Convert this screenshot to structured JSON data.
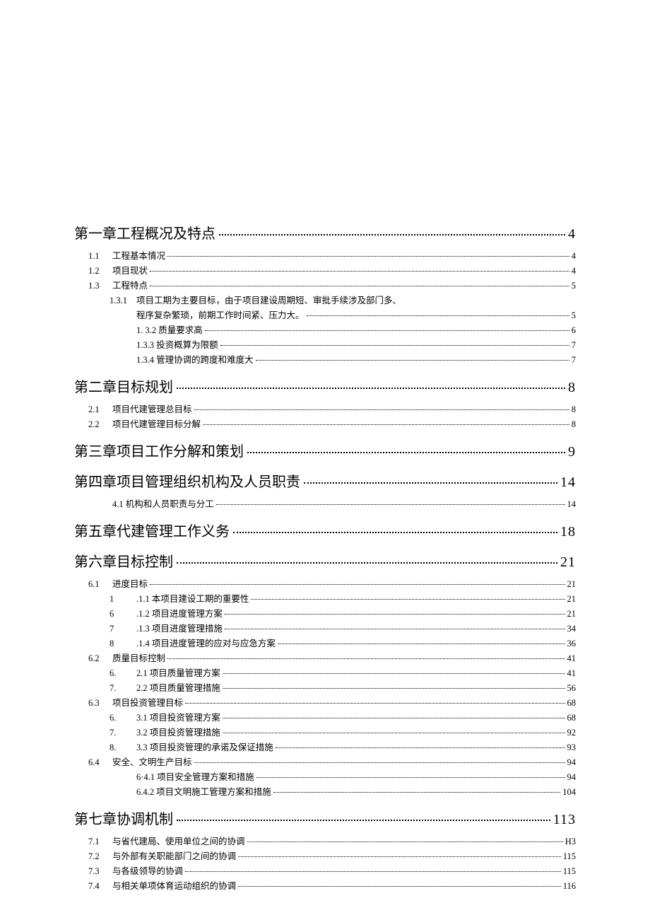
{
  "toc": [
    {
      "lvl": 1,
      "num": "",
      "title": "第一章工程概况及特点",
      "page": "4"
    },
    {
      "lvl": 2,
      "num": "1.1",
      "title": "工程基本情况",
      "page": "4"
    },
    {
      "lvl": 2,
      "num": "1.2",
      "title": "项目现状",
      "page": "4"
    },
    {
      "lvl": 2,
      "num": "1.3",
      "title": "工程特点",
      "page": "5"
    },
    {
      "lvl": 3,
      "num": "1.3.1",
      "title": "项目工期为主要目标，由于项目建设周期短、审批手续涉及部门多、",
      "page": ""
    },
    {
      "lvl": 3,
      "num": "",
      "title": "程序复杂繁琐，前期工作时间紧、压力大。",
      "page": "5"
    },
    {
      "lvl": 3,
      "num": "",
      "title": "1. 3.2 质量要求高",
      "page": "6"
    },
    {
      "lvl": 3,
      "num": "",
      "title": "1.3.3 投资概算为限额",
      "page": "7"
    },
    {
      "lvl": 3,
      "num": "",
      "title": "1.3.4 管理协调的跨度和难度大",
      "page": "7"
    },
    {
      "lvl": 1,
      "num": "",
      "title": "第二章目标规划",
      "page": "8"
    },
    {
      "lvl": 2,
      "num": "2.1",
      "title": "项目代建管理总目标",
      "page": "8"
    },
    {
      "lvl": 2,
      "num": "2.2",
      "title": "项目代建管理目标分解",
      "page": "8"
    },
    {
      "lvl": 1,
      "num": "",
      "title": "第三章项目工作分解和策划",
      "page": "9"
    },
    {
      "lvl": 1,
      "num": "",
      "title": "第四章项目管理组织机构及人员职责",
      "page": "14"
    },
    {
      "lvl": 2,
      "num": "",
      "title": "4.1 机构和人员职责与分工",
      "page": "14"
    },
    {
      "lvl": 1,
      "num": "",
      "title": "第五章代建管理工作义务",
      "page": "18"
    },
    {
      "lvl": 1,
      "num": "",
      "title": "第六章目标控制",
      "page": "21"
    },
    {
      "lvl": 2,
      "num": "6.1",
      "title": "进度目标",
      "page": "21"
    },
    {
      "lvl": 3,
      "num": "1",
      "title": ".1.1 本项目建设工期的重要性",
      "page": "21"
    },
    {
      "lvl": 3,
      "num": "6",
      "title": ".1.2 项目进度管理方案",
      "page": "21"
    },
    {
      "lvl": 3,
      "num": "7",
      "title": ".1.3 项目进度管理措施",
      "page": "34"
    },
    {
      "lvl": 3,
      "num": "8",
      "title": ".1.4 项目进度管理的应对与应急方案",
      "page": "36"
    },
    {
      "lvl": 2,
      "num": "6.2",
      "title": "质量目标控制",
      "page": "41"
    },
    {
      "lvl": 3,
      "num": "6.",
      "title": "2.1 项目质量管理方案",
      "page": "41"
    },
    {
      "lvl": 3,
      "num": "7.",
      "title": "2.2 项目质量管理措施",
      "page": "56"
    },
    {
      "lvl": 2,
      "num": "6.3",
      "title": "项目投资管理目标",
      "page": "68"
    },
    {
      "lvl": 3,
      "num": "6.",
      "title": "3.1 项目投资管理方案",
      "page": "68"
    },
    {
      "lvl": 3,
      "num": "7.",
      "title": "3.2 项目投资管理措施",
      "page": "92"
    },
    {
      "lvl": 3,
      "num": "8.",
      "title": "3.3 项目投资管理的承诺及保证措施",
      "page": "93"
    },
    {
      "lvl": 2,
      "num": "6.4",
      "title": "安全、文明生产目标",
      "page": "94"
    },
    {
      "lvl": 3,
      "num": "",
      "title": "6·4.1 项目安全管理方案和措施",
      "page": "94"
    },
    {
      "lvl": 3,
      "num": "",
      "title": "6.4.2 项目文明施工管理方案和措施",
      "page": "104"
    },
    {
      "lvl": 1,
      "num": "",
      "title": "第七章协调机制",
      "page": "113"
    },
    {
      "lvl": 2,
      "num": "7.1",
      "title": "与省代建局、使用单位之间的协调",
      "page": "H3"
    },
    {
      "lvl": 2,
      "num": "7.2",
      "title": "与外部有关职能部门之间的协调",
      "page": "115"
    },
    {
      "lvl": 2,
      "num": "7.3",
      "title": "与各级领导的协调",
      "page": "115"
    },
    {
      "lvl": 2,
      "num": "7.4",
      "title": "与相关单项体育运动组织的协调",
      "page": "116"
    }
  ]
}
